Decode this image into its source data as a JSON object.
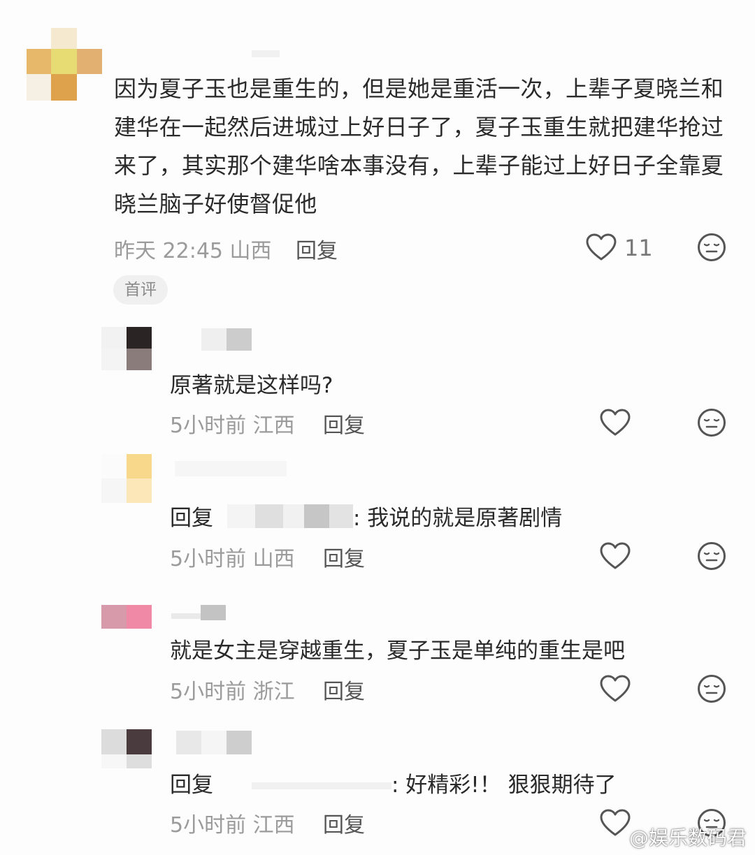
{
  "top_comment": {
    "text": "因为夏子玉也是重生的，但是她是重活一次，上辈子夏晓兰和建华在一起然后进城过上好日子了，夏子玉重生就把建华抢过来了，其实那个建华啥本事没有，上辈子能过上好日子全靠夏晓兰脑子好使督促他",
    "meta": "昨天 22:45 山西",
    "reply_label": "回复",
    "like_count": "11",
    "tag": "首评"
  },
  "replies": [
    {
      "text": "原著就是这样吗?",
      "meta": "5小时前 江西",
      "reply_label": "回复"
    },
    {
      "prefix": "回复",
      "text": ": 我说的就是原著剧情",
      "meta": "5小时前 山西",
      "reply_label": "回复"
    },
    {
      "text": "就是女主是穿越重生，夏子玉是单纯的重生是吧",
      "meta": "5小时前 浙江",
      "reply_label": "回复"
    },
    {
      "prefix": "回复",
      "text": ": 好精彩!！ 狠狠期待了",
      "meta": "5小时前 江西",
      "reply_label": "回复"
    }
  ],
  "watermark": "@娱乐数码君",
  "icons": {
    "like": "heart-outline-icon",
    "dislike": "neutral-face-icon"
  },
  "colors": {
    "text": "#2a2a2a",
    "meta": "#9b9b9b",
    "icon": "#555555"
  }
}
